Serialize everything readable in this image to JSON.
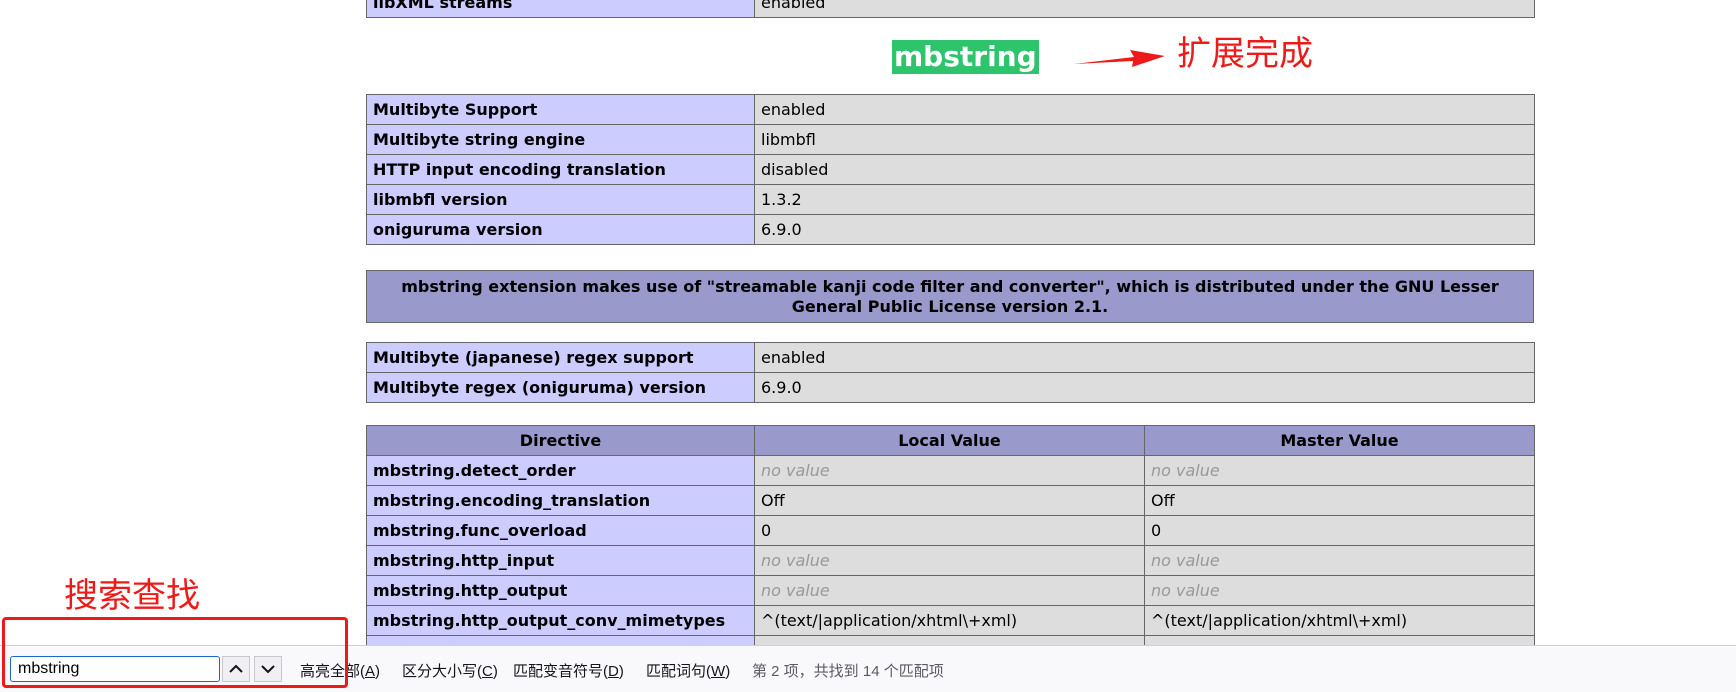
{
  "prev_table": {
    "rows": [
      {
        "name": "libXML streams",
        "value": "enabled"
      }
    ]
  },
  "section": {
    "title": "mbstring"
  },
  "annotations": {
    "complete_text": "扩展完成",
    "search_text": "搜索查找"
  },
  "support_table": {
    "rows": [
      {
        "name": "Multibyte Support",
        "value": "enabled"
      },
      {
        "name": "Multibyte string engine",
        "value": "libmbfl"
      },
      {
        "name": "HTTP input encoding translation",
        "value": "disabled"
      },
      {
        "name": "libmbfl version",
        "value": "1.3.2"
      },
      {
        "name": "oniguruma version",
        "value": "6.9.0"
      }
    ]
  },
  "license_note": "mbstring extension makes use of \"streamable kanji code filter and converter\", which is distributed under the GNU Lesser General Public License version 2.1.",
  "regex_table": {
    "rows": [
      {
        "name": "Multibyte (japanese) regex support",
        "value": "enabled"
      },
      {
        "name": "Multibyte regex (oniguruma) version",
        "value": "6.9.0"
      }
    ]
  },
  "directive_table": {
    "headers": [
      "Directive",
      "Local Value",
      "Master Value"
    ],
    "rows": [
      {
        "name": "mbstring.detect_order",
        "local": "no value",
        "master": "no value"
      },
      {
        "name": "mbstring.encoding_translation",
        "local": "Off",
        "master": "Off"
      },
      {
        "name": "mbstring.func_overload",
        "local": "0",
        "master": "0"
      },
      {
        "name": "mbstring.http_input",
        "local": "no value",
        "master": "no value"
      },
      {
        "name": "mbstring.http_output",
        "local": "no value",
        "master": "no value"
      },
      {
        "name": "mbstring.http_output_conv_mimetypes",
        "local": "^(text/|application/xhtml\\+xml)",
        "master": "^(text/|application/xhtml\\+xml)"
      }
    ]
  },
  "findbar": {
    "query": "mbstring",
    "highlight_all": "高亮全部",
    "highlight_all_key": "A",
    "match_case": "区分大小写",
    "match_case_key": "C",
    "match_diacritics": "匹配变音符号",
    "match_diacritics_key": "D",
    "whole_words": "匹配词句",
    "whole_words_key": "W",
    "status": "第 2 项，共找到 14 个匹配项"
  },
  "colors": {
    "label_cell": "#ccccff",
    "value_cell": "#dddddd",
    "header_cell": "#9999cc",
    "annotation_red": "#ee1a1a",
    "find_highlight": "#2ec46b"
  }
}
